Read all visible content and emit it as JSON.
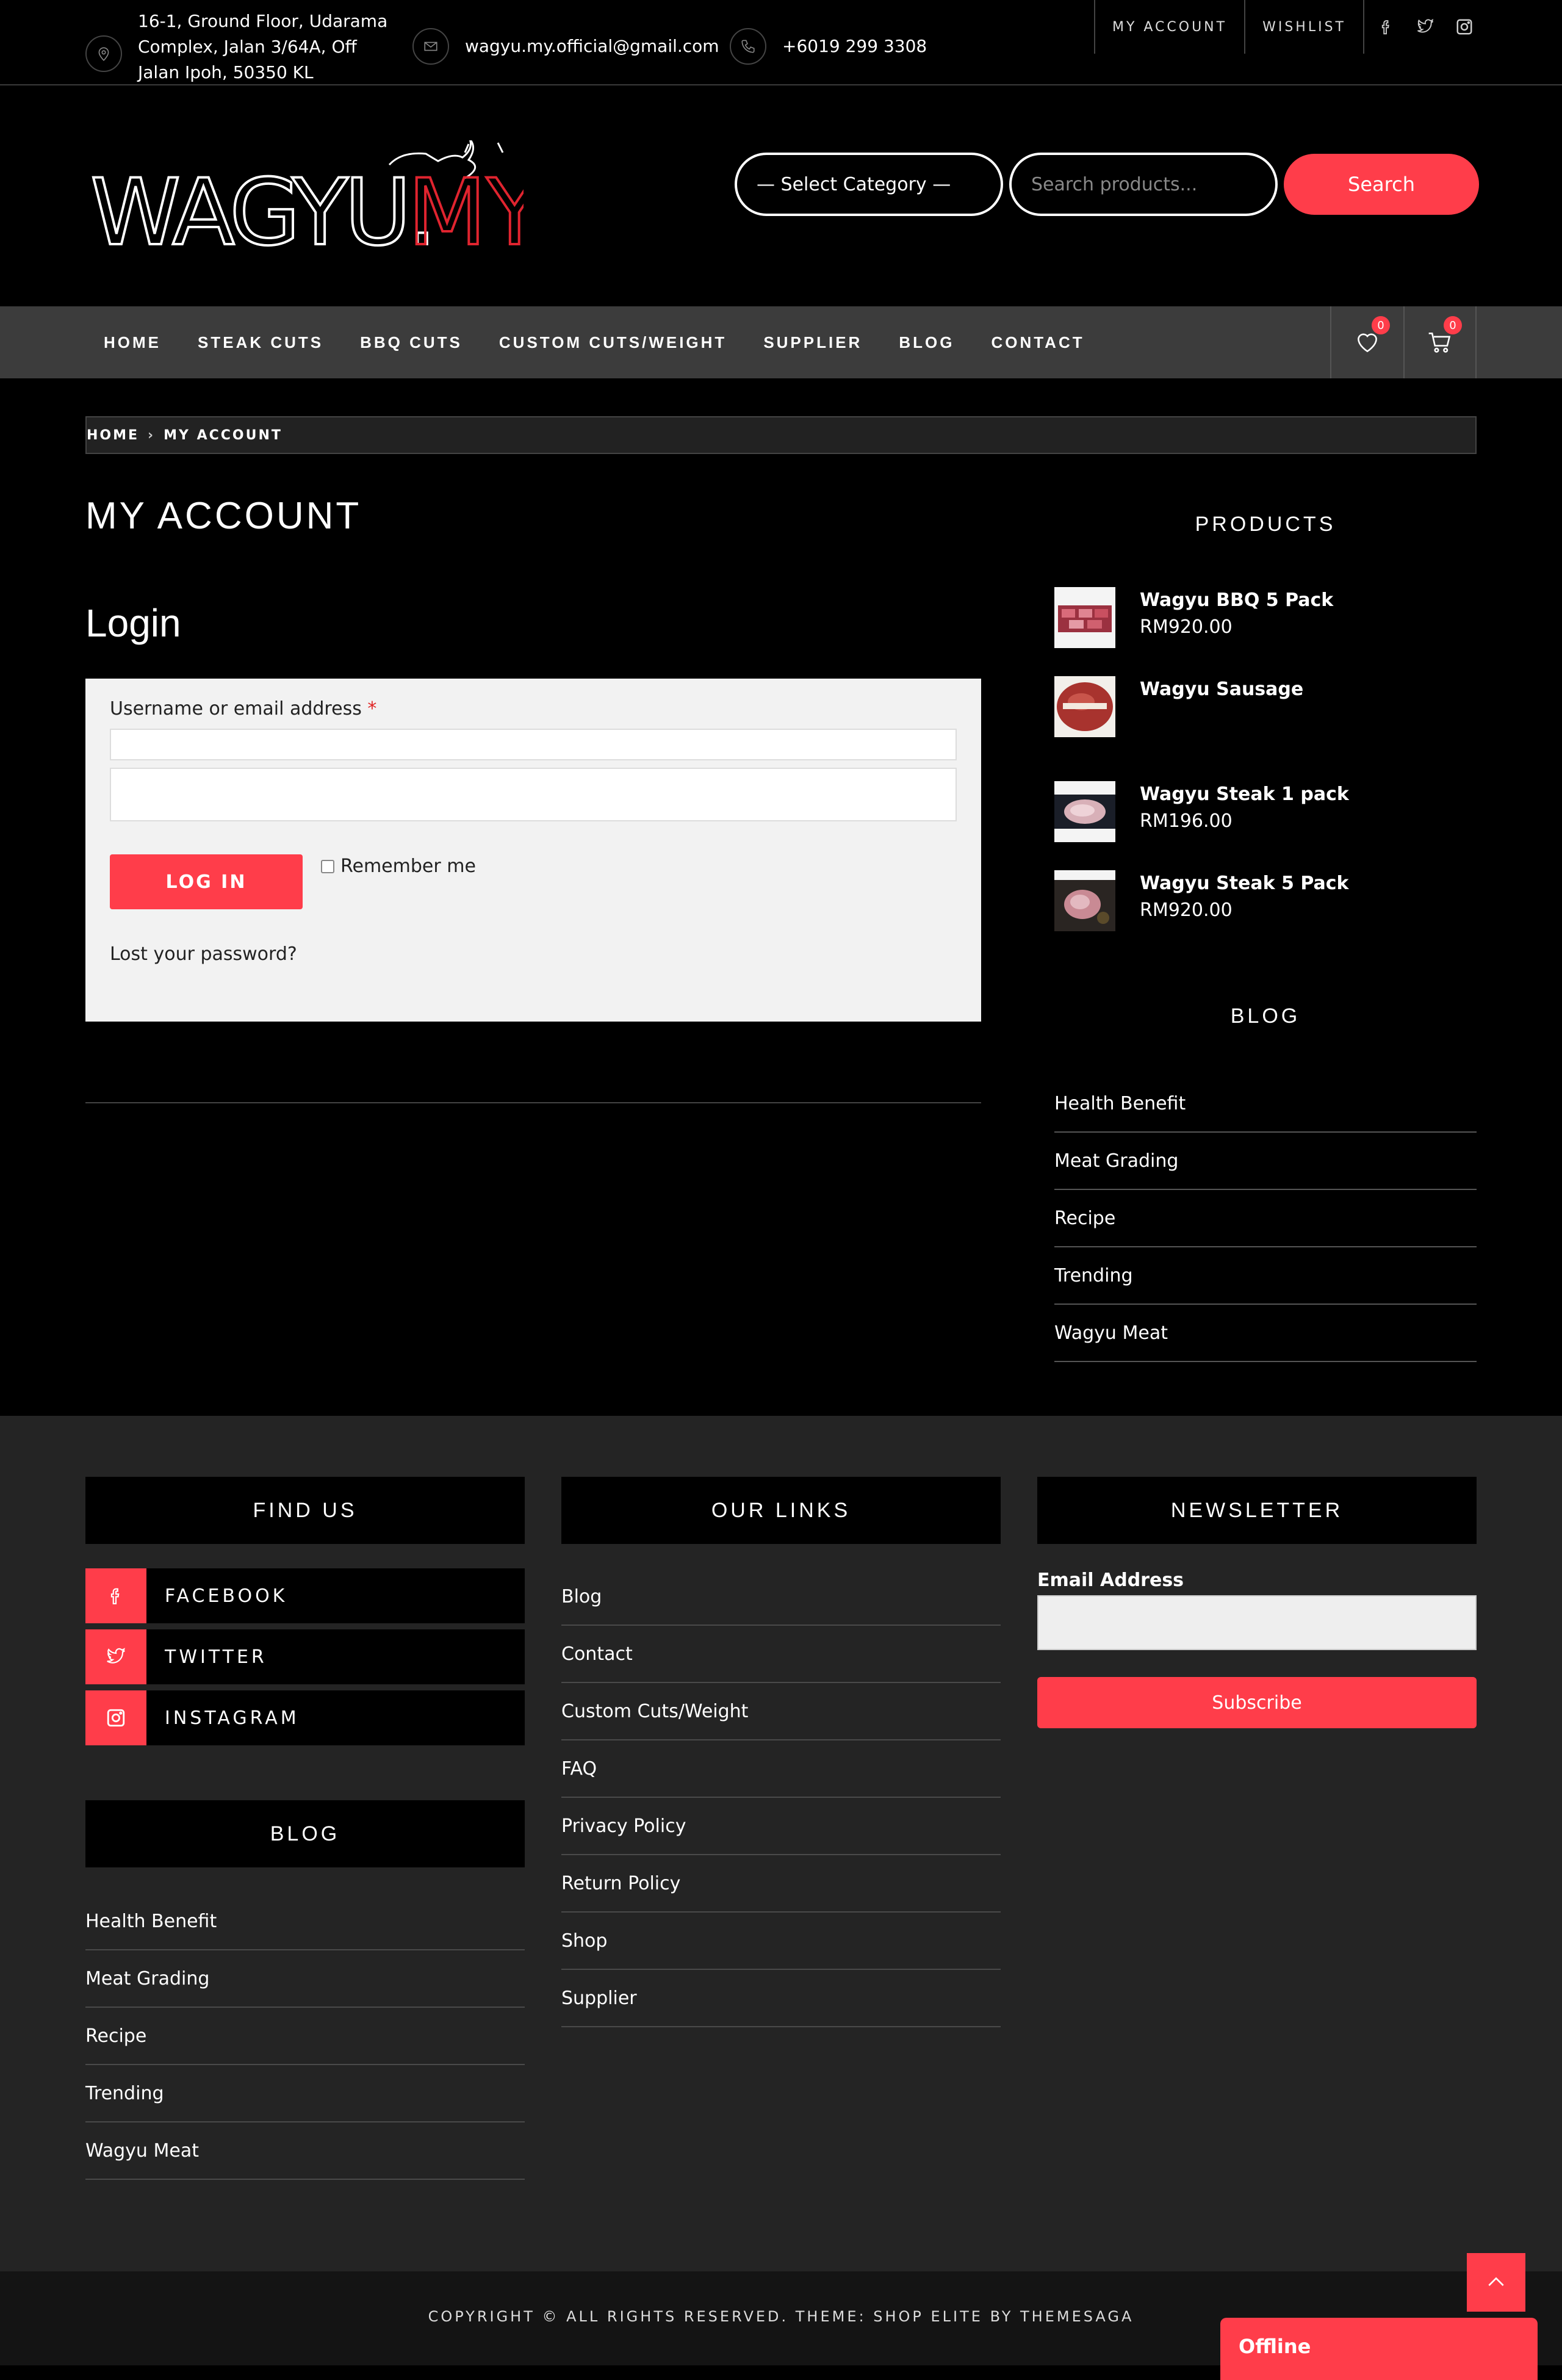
{
  "topbar": {
    "address": [
      "16-1, Ground Floor, Udarama",
      "Complex, Jalan 3/64A, Off",
      "Jalan Ipoh, 50350 KL"
    ],
    "email": "wagyu.my.official@gmail.com",
    "phone": "+6019 299 3308",
    "links": [
      "MY ACCOUNT",
      "WISHLIST"
    ]
  },
  "header": {
    "logo_main": "WAGYU.",
    "logo_accent": "MY",
    "category_select": "— Select Category —",
    "search_placeholder": "Search products...",
    "search_button": "Search"
  },
  "nav": {
    "items": [
      "HOME",
      "STEAK CUTS",
      "BBQ CUTS",
      "CUSTOM CUTS/WEIGHT",
      "SUPPLIER",
      "BLOG",
      "CONTACT"
    ],
    "wishlist_count": "0",
    "cart_count": "0"
  },
  "breadcrumb": {
    "home": "HOME",
    "current": "MY ACCOUNT"
  },
  "main": {
    "title": "MY ACCOUNT",
    "login_heading": "Login",
    "username_label": "Username or email address",
    "required_mark": "*",
    "login_button": "LOG IN",
    "remember_label": "Remember me",
    "lost_password": "Lost your password?"
  },
  "sidebar": {
    "products_heading": "PRODUCTS",
    "products": [
      {
        "name": "Wagyu BBQ 5 Pack",
        "price": "RM920.00"
      },
      {
        "name": "Wagyu Sausage",
        "price": ""
      },
      {
        "name": "Wagyu Steak 1 pack",
        "price": "RM196.00"
      },
      {
        "name": "Wagyu Steak 5 Pack",
        "price": "RM920.00"
      }
    ],
    "blog_heading": "BLOG",
    "blog_items": [
      "Health Benefit",
      "Meat Grading",
      "Recipe",
      "Trending",
      "Wagyu Meat"
    ]
  },
  "footer": {
    "find_us": "FIND US",
    "social": [
      "FACEBOOK",
      "TWITTER",
      "INSTAGRAM"
    ],
    "blog_heading": "BLOG",
    "blog_items": [
      "Health Benefit",
      "Meat Grading",
      "Recipe",
      "Trending",
      "Wagyu Meat"
    ],
    "links_heading": "OUR LINKS",
    "links": [
      "Blog",
      "Contact",
      "Custom Cuts/Weight",
      "FAQ",
      "Privacy Policy",
      "Return Policy",
      "Shop",
      "Supplier"
    ],
    "newsletter_heading": "NEWSLETTER",
    "email_label": "Email Address",
    "subscribe_button": "Subscribe",
    "copyright": "COPYRIGHT © ALL RIGHTS RESERVED. THEME: SHOP ELITE BY THEMESAGA",
    "chat_status": "Offline"
  },
  "colors": {
    "accent": "#ff3d4a",
    "nav_bg": "#3c3c3c",
    "footer_bg": "#242424"
  }
}
